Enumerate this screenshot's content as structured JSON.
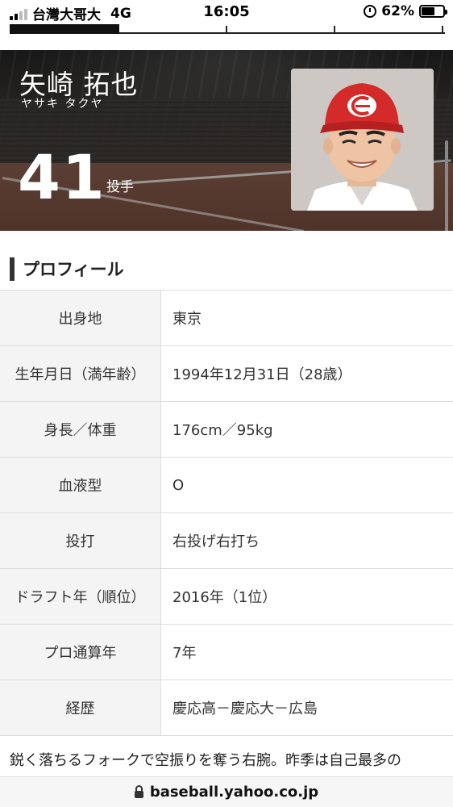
{
  "status_bar": {
    "carrier": "台灣大哥大",
    "network": "4G",
    "time": "16:05",
    "battery": "62%",
    "battery_level": 0.62,
    "icons": [
      "signal-icon",
      "alarm-icon",
      "battery-icon"
    ]
  },
  "player": {
    "name": "矢崎 拓也",
    "kana": "ヤサキ タクヤ",
    "number": "41",
    "position": "投手"
  },
  "profile": {
    "heading": "プロフィール",
    "rows": [
      {
        "label": "出身地",
        "value": "東京"
      },
      {
        "label": "生年月日（満年齢）",
        "value": "1994年12月31日（28歳）"
      },
      {
        "label": "身長／体重",
        "value": "176cm／95kg"
      },
      {
        "label": "血液型",
        "value": "O"
      },
      {
        "label": "投打",
        "value": "右投げ右打ち"
      },
      {
        "label": "ドラフト年（順位）",
        "value": "2016年（1位）"
      },
      {
        "label": "プロ通算年",
        "value": "7年"
      },
      {
        "label": "経歴",
        "value": "慶応高－慶応大－広島"
      }
    ]
  },
  "bio_text": "鋭く落ちるフォークで空振りを奪う右腕。昨季は自己最多の",
  "url_bar": {
    "url": "baseball.yahoo.co.jp"
  },
  "colors": {
    "cap_red": "#d42a2a",
    "header_dark": "#2a2a2a",
    "label_bg": "#f4f4f4"
  }
}
